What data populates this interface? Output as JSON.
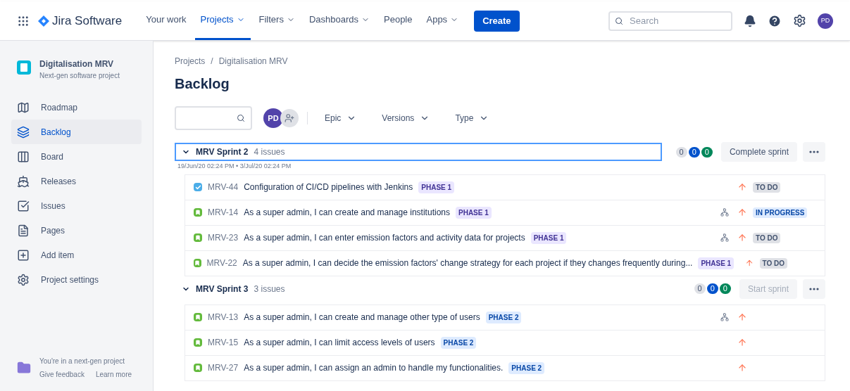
{
  "topbar": {
    "product": "Jira Software",
    "nav": [
      {
        "label": "Your work",
        "dropdown": false,
        "selected": false
      },
      {
        "label": "Projects",
        "dropdown": true,
        "selected": true
      },
      {
        "label": "Filters",
        "dropdown": true,
        "selected": false
      },
      {
        "label": "Dashboards",
        "dropdown": true,
        "selected": false
      },
      {
        "label": "People",
        "dropdown": false,
        "selected": false
      },
      {
        "label": "Apps",
        "dropdown": true,
        "selected": false
      }
    ],
    "create": "Create",
    "search": {
      "placeholder": "Search"
    },
    "avatar": "PD"
  },
  "sidebar": {
    "project": {
      "name": "Digitalisation MRV",
      "type": "Next-gen software project"
    },
    "items": [
      {
        "label": "Roadmap",
        "kind": "roadmap",
        "selected": false
      },
      {
        "label": "Backlog",
        "kind": "backlog",
        "selected": true
      },
      {
        "label": "Board",
        "kind": "board",
        "selected": false
      },
      {
        "label": "Releases",
        "kind": "releases",
        "selected": false
      },
      {
        "label": "Issues",
        "kind": "issues",
        "selected": false
      },
      {
        "label": "Pages",
        "kind": "pages",
        "selected": false
      },
      {
        "label": "Add item",
        "kind": "add",
        "selected": false
      },
      {
        "label": "Project settings",
        "kind": "settings",
        "selected": false
      }
    ],
    "footer": {
      "text": "You're in a next-gen project",
      "links": [
        "Give feedback",
        "Learn more"
      ]
    }
  },
  "breadcrumbs": [
    "Projects",
    "Digitalisation MRV"
  ],
  "breadcrumb_separator": "/",
  "title": "Backlog",
  "filters": {
    "avatar": "PD",
    "dropdowns": [
      "Epic",
      "Versions",
      "Type"
    ]
  },
  "sprints": [
    {
      "name": "MRV Sprint 2",
      "count": "4 issues",
      "dates": "19/Jun/20 02:24 PM • 3/Jul/20 02:24 PM",
      "focused": true,
      "counts": [
        "0",
        "0",
        "0"
      ],
      "action": "Complete sprint",
      "action_disabled": false,
      "issues": [
        {
          "kind": "task",
          "key": "MRV-44",
          "summary": "Configuration of CI/CD pipelines with Jenkins",
          "epic": {
            "label": "PHASE 1",
            "color": "#eae6ff"
          },
          "subtasks": false,
          "status": {
            "label": "TO DO",
            "color": "#dfe1e6"
          }
        },
        {
          "kind": "story",
          "key": "MRV-14",
          "summary": "As a super admin, I can create and manage institutions",
          "epic": {
            "label": "PHASE 1",
            "color": "#eae6ff"
          },
          "subtasks": true,
          "status": {
            "label": "IN PROGRESS",
            "color": "#deebff"
          }
        },
        {
          "kind": "story",
          "key": "MRV-23",
          "summary": "As a super admin, I can enter emission factors and activity data for projects",
          "epic": {
            "label": "PHASE 1",
            "color": "#eae6ff"
          },
          "subtasks": true,
          "status": {
            "label": "TO DO",
            "color": "#dfe1e6"
          }
        },
        {
          "kind": "story",
          "key": "MRV-22",
          "summary": "As a super admin, I can decide the emission factors' change strategy for each project if they changes frequently during...",
          "epic": {
            "label": "PHASE 1",
            "color": "#eae6ff"
          },
          "subtasks": false,
          "status": {
            "label": "TO DO",
            "color": "#dfe1e6"
          }
        }
      ]
    },
    {
      "name": "MRV Sprint 3",
      "count": "3 issues",
      "focused": false,
      "counts": [
        "0",
        "0",
        "0"
      ],
      "action": "Start sprint",
      "action_disabled": true,
      "issues": [
        {
          "kind": "story",
          "key": "MRV-13",
          "summary": "As a super admin, I can create and manage other type of users",
          "epic": {
            "label": "PHASE 2",
            "color": "#deebff"
          },
          "subtasks": true
        },
        {
          "kind": "story",
          "key": "MRV-15",
          "summary": "As a super admin, I can limit access levels of users",
          "epic": {
            "label": "PHASE 2",
            "color": "#deebff"
          },
          "subtasks": false
        },
        {
          "kind": "story",
          "key": "MRV-27",
          "summary": "As a super admin, I can assign an admin to handle my functionalities.",
          "epic": {
            "label": "PHASE 2",
            "color": "#deebff"
          },
          "subtasks": false
        }
      ]
    }
  ]
}
